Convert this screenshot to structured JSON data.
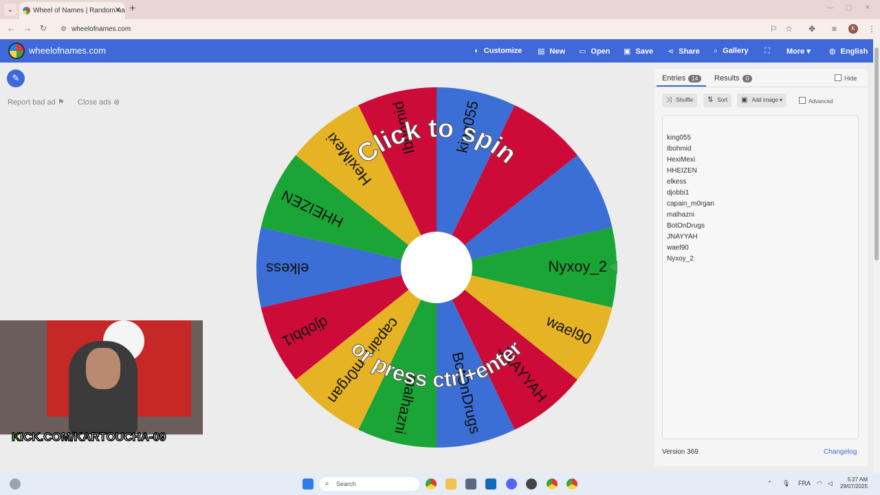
{
  "browser": {
    "tab_title": "Wheel of Names | Random nam",
    "tab_close": "✕",
    "new_tab": "+",
    "url": "wheelofnames.com",
    "profile_initial": "K"
  },
  "header": {
    "brand": "wheelofnames.com",
    "nav": [
      {
        "icon": "palette-icon",
        "label": "Customize"
      },
      {
        "icon": "file-icon",
        "label": "New"
      },
      {
        "icon": "folder-icon",
        "label": "Open"
      },
      {
        "icon": "save-icon",
        "label": "Save"
      },
      {
        "icon": "share-icon",
        "label": "Share"
      },
      {
        "icon": "search-icon",
        "label": "Gallery"
      },
      {
        "icon": "fullscreen-icon",
        "label": ""
      },
      {
        "icon": "chevron-down-icon",
        "label": "More"
      },
      {
        "icon": "globe-icon",
        "label": "English"
      }
    ]
  },
  "ads": {
    "report": "Report bad ad",
    "close": "Close ads"
  },
  "overlay": {
    "kick_prefix": "K",
    "kick_text": "ICK.COM/KARTOUCHA-09"
  },
  "wheel": {
    "top_text": "Click to spin",
    "bottom_text": "or press ctrl+enter",
    "segments": [
      {
        "label": "Nyxoy_2",
        "color": "#1aa536"
      },
      {
        "label": "wael90",
        "color": "#e6b325"
      },
      {
        "label": "JNAYYAH",
        "color": "#cc0b38"
      },
      {
        "label": "BotOnDrugs",
        "color": "#3b6fd6"
      },
      {
        "label": "malhazni",
        "color": "#1aa536"
      },
      {
        "label": "capain_m0rgan",
        "color": "#e6b325"
      },
      {
        "label": "djobbi1",
        "color": "#cc0b38"
      },
      {
        "label": "elkess",
        "color": "#3b6fd6"
      },
      {
        "label": "HHEIZEN",
        "color": "#1aa536"
      },
      {
        "label": "HexiMexi",
        "color": "#e6b325"
      },
      {
        "label": "Ibohmid",
        "color": "#cc0b38"
      },
      {
        "label": "king055",
        "color": "#3b6fd6"
      },
      {
        "label": "",
        "color": "#cc0b38"
      },
      {
        "label": "",
        "color": "#3b6fd6"
      }
    ]
  },
  "panel": {
    "entries_tab": "Entries",
    "entries_count": "14",
    "results_tab": "Results",
    "results_count": "0",
    "hide": "Hide",
    "shuffle": "Shuffle",
    "sort": "Sort",
    "add_image": "Add image",
    "advanced": "Advanced",
    "entries": [
      "king055",
      "Ibohmid",
      "HexiMexi",
      "HHEIZEN",
      "elkess",
      "djobbi1",
      "capain_m0rgan",
      "malhazni",
      "BotOnDrugs",
      "JNAYYAH",
      "wael90",
      "Nyxoy_2"
    ],
    "version": "Version 369",
    "changelog": "Changelog"
  },
  "taskbar": {
    "search_placeholder": "Search",
    "language": "FRA",
    "time": "5:27 AM",
    "date": "29/07/2025"
  }
}
